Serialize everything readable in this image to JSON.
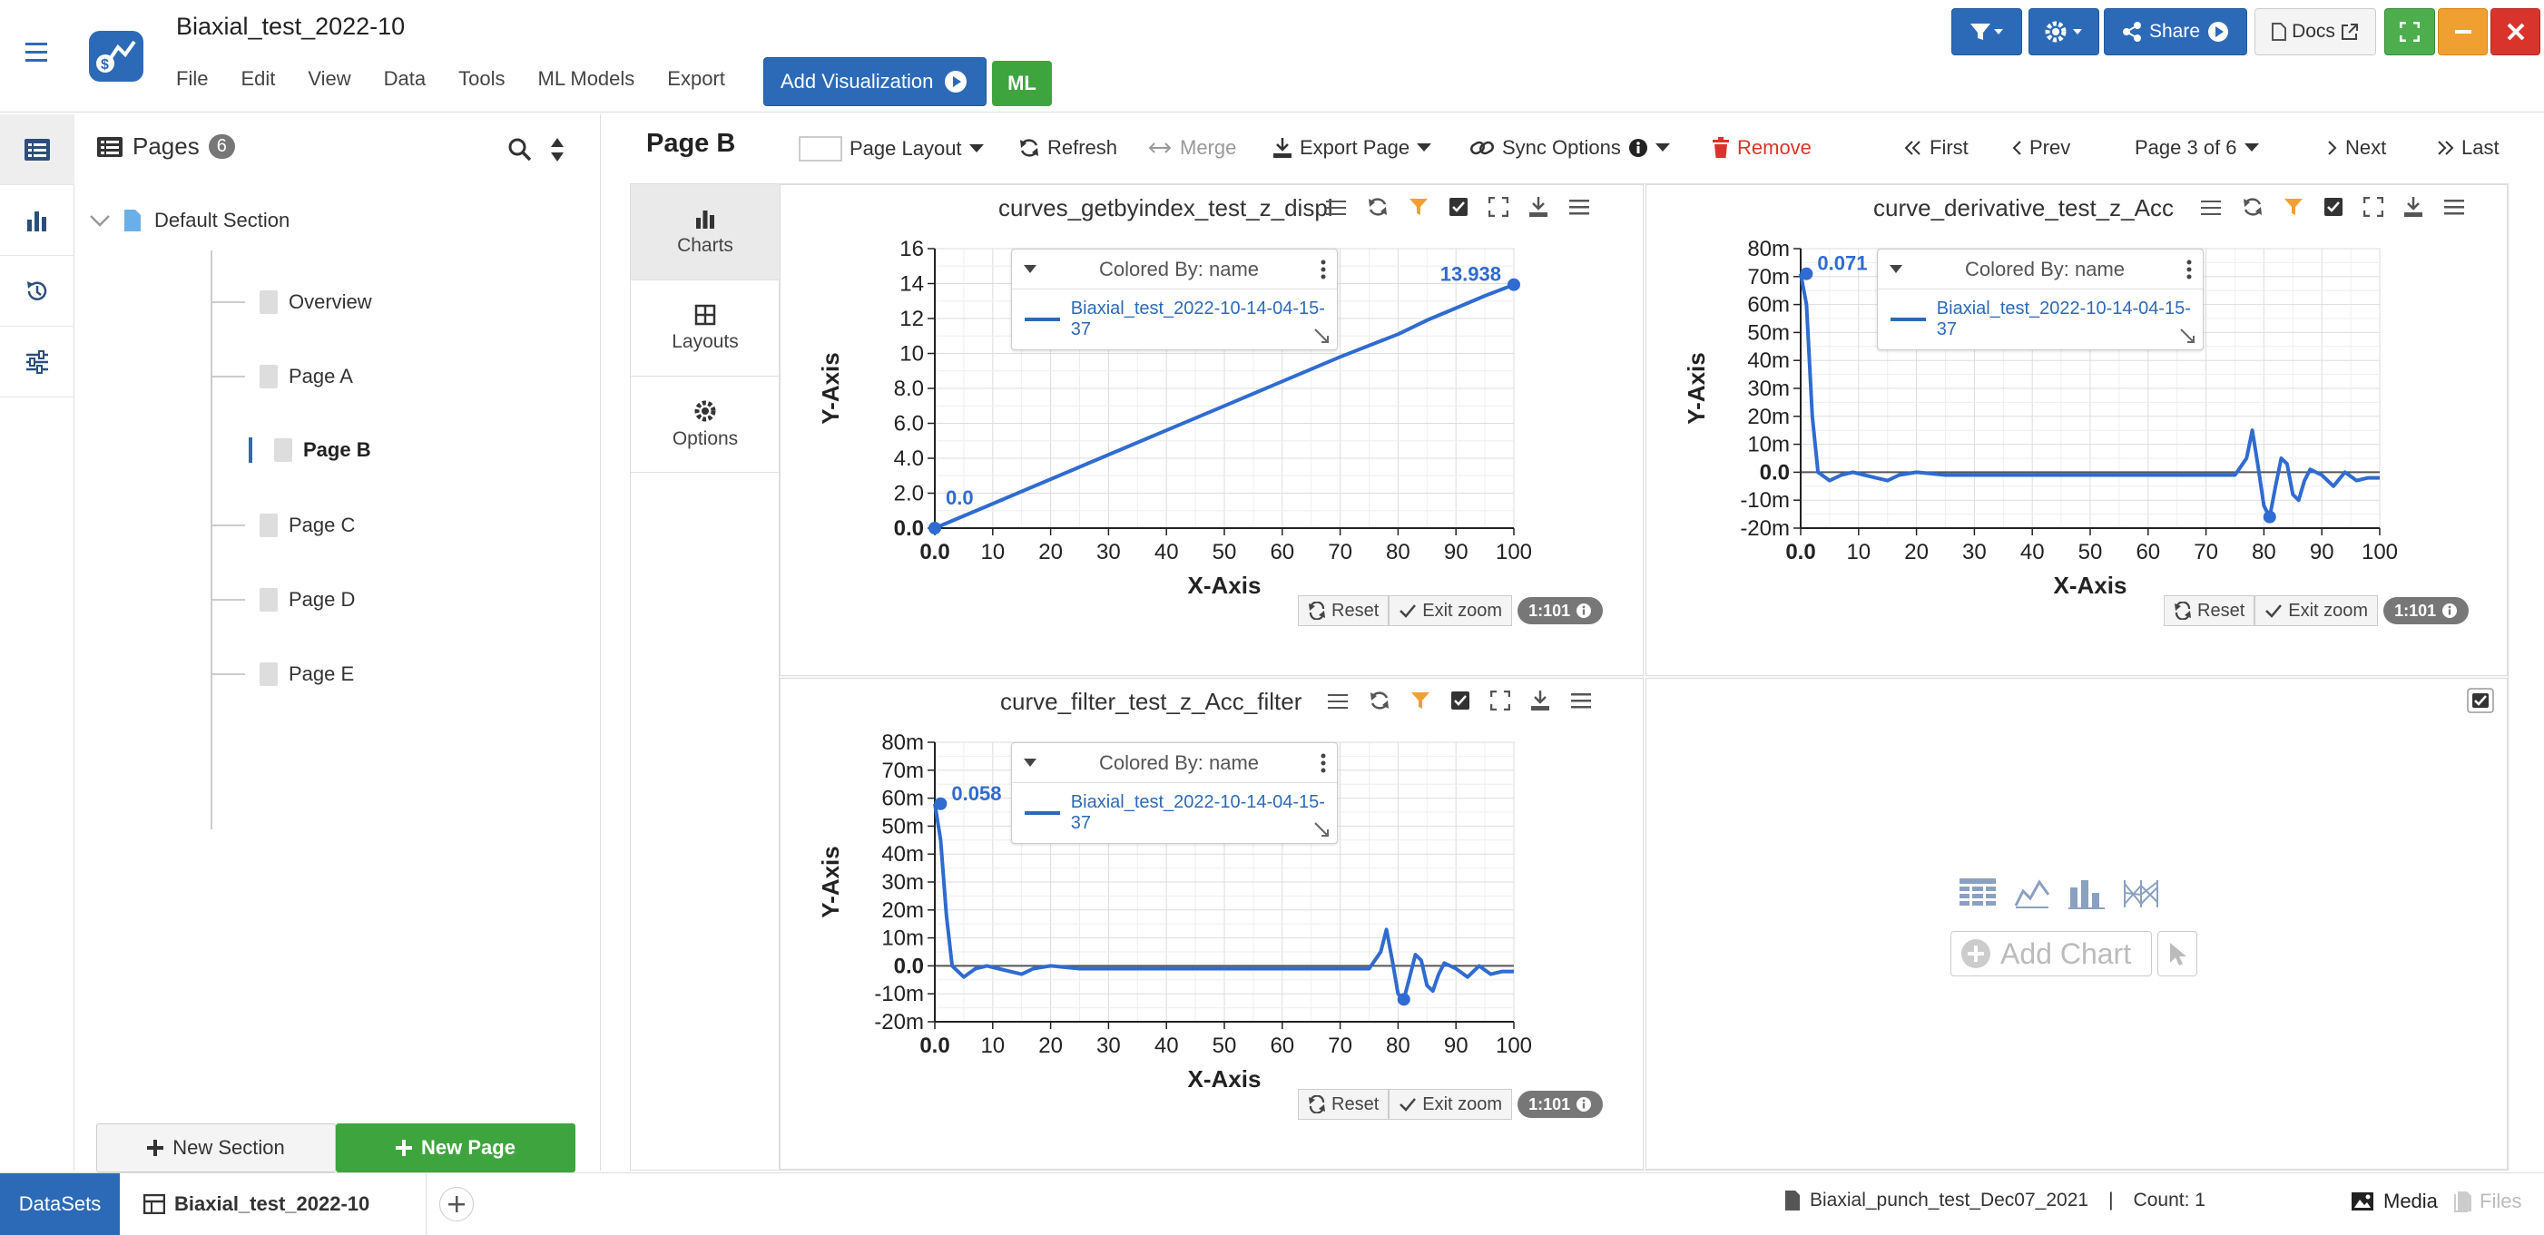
{
  "header": {
    "app_title": "Biaxial_test_2022-10",
    "menu": [
      "File",
      "Edit",
      "View",
      "Data",
      "Tools",
      "ML Models",
      "Export"
    ],
    "add_visualization": "Add Visualization",
    "ml": "ML",
    "share": "Share",
    "docs": "Docs"
  },
  "pages_panel": {
    "title": "Pages",
    "count": "6",
    "section": "Default Section",
    "pages": [
      "Overview",
      "Page A",
      "Page B",
      "Page C",
      "Page D",
      "Page E"
    ],
    "active_page": "Page B",
    "new_section": "New Section",
    "new_page": "New Page"
  },
  "toolbar": {
    "page_title": "Page B",
    "page_layout": "Page Layout",
    "refresh": "Refresh",
    "merge": "Merge",
    "export_page": "Export Page",
    "sync_options": "Sync Options",
    "remove": "Remove",
    "first": "First",
    "prev": "Prev",
    "page_indicator": "Page 3 of 6",
    "next": "Next",
    "last": "Last"
  },
  "side_tabs": [
    "Charts",
    "Layouts",
    "Options"
  ],
  "legend": {
    "colored_by": "Colored By: name",
    "entry": "Biaxial_test_2022-10-14-04-15-37"
  },
  "zoom": {
    "reset": "Reset",
    "exit_zoom": "Exit zoom",
    "ratio": "1:101"
  },
  "empty_panel": {
    "add_chart": "Add Chart"
  },
  "chart_data": [
    {
      "type": "line",
      "title": "curves_getbyindex_test_z_displ",
      "xlabel": "X-Axis",
      "ylabel": "Y-Axis",
      "xlim": [
        0,
        100
      ],
      "ylim": [
        0,
        16
      ],
      "xticks": [
        "0.0",
        "10",
        "20",
        "30",
        "40",
        "50",
        "60",
        "70",
        "80",
        "90",
        "100"
      ],
      "yticks": [
        "0.0",
        "2.0",
        "4.0",
        "6.0",
        "8.0",
        "10",
        "12",
        "14",
        "16"
      ],
      "series": [
        {
          "name": "Biaxial_test_2022-10-14-04-15-37",
          "x": [
            0,
            10,
            20,
            30,
            40,
            50,
            60,
            70,
            80,
            85,
            90,
            95,
            100
          ],
          "y": [
            0,
            1.4,
            2.8,
            4.2,
            5.6,
            7.0,
            8.4,
            9.8,
            11.1,
            11.9,
            12.6,
            13.3,
            13.938
          ]
        }
      ],
      "annotations": [
        {
          "x": 0,
          "y": 0,
          "text": "0.0"
        },
        {
          "x": 100,
          "y": 13.938,
          "text": "13.938"
        }
      ]
    },
    {
      "type": "line",
      "title": "curve_derivative_test_z_Acc",
      "xlabel": "X-Axis",
      "ylabel": "Y-Axis",
      "xlim": [
        0,
        100
      ],
      "ylim": [
        -0.02,
        0.08
      ],
      "xticks": [
        "0.0",
        "10",
        "20",
        "30",
        "40",
        "50",
        "60",
        "70",
        "80",
        "90",
        "100"
      ],
      "yticks": [
        "-20m",
        "-10m",
        "0.0",
        "10m",
        "20m",
        "30m",
        "40m",
        "50m",
        "60m",
        "70m",
        "80m"
      ],
      "series": [
        {
          "name": "Biaxial_test_2022-10-14-04-15-37",
          "x": [
            0,
            1,
            2,
            3,
            5,
            7,
            9,
            11,
            13,
            15,
            17,
            20,
            25,
            30,
            40,
            50,
            60,
            70,
            75,
            77,
            78,
            79,
            80,
            81,
            82,
            83,
            84,
            85,
            86,
            87,
            88,
            90,
            92,
            94,
            96,
            98,
            100
          ],
          "y": [
            0.071,
            0.06,
            0.02,
            0.0,
            -0.003,
            -0.001,
            0.0,
            -0.001,
            -0.002,
            -0.003,
            -0.001,
            0.0,
            -0.001,
            -0.001,
            -0.001,
            -0.001,
            -0.001,
            -0.001,
            -0.001,
            0.005,
            0.015,
            0.002,
            -0.012,
            -0.016,
            -0.005,
            0.005,
            0.003,
            -0.008,
            -0.01,
            -0.003,
            0.001,
            -0.001,
            -0.005,
            0.0,
            -0.003,
            -0.002,
            -0.002
          ]
        }
      ],
      "annotations": [
        {
          "x": 1,
          "y": 0.071,
          "text": "0.071"
        }
      ]
    },
    {
      "type": "line",
      "title": "curve_filter_test_z_Acc_filter",
      "xlabel": "X-Axis",
      "ylabel": "Y-Axis",
      "xlim": [
        0,
        100
      ],
      "ylim": [
        -0.02,
        0.08
      ],
      "xticks": [
        "0.0",
        "10",
        "20",
        "30",
        "40",
        "50",
        "60",
        "70",
        "80",
        "90",
        "100"
      ],
      "yticks": [
        "-20m",
        "-10m",
        "0.0",
        "10m",
        "20m",
        "30m",
        "40m",
        "50m",
        "60m",
        "70m",
        "80m"
      ],
      "series": [
        {
          "name": "Biaxial_test_2022-10-14-04-15-37",
          "x": [
            0,
            1,
            2,
            3,
            5,
            7,
            9,
            11,
            13,
            15,
            17,
            20,
            25,
            30,
            40,
            50,
            60,
            70,
            75,
            77,
            78,
            79,
            80,
            81,
            82,
            83,
            84,
            85,
            86,
            87,
            88,
            90,
            92,
            94,
            96,
            98,
            100
          ],
          "y": [
            0.058,
            0.045,
            0.018,
            0.0,
            -0.004,
            -0.001,
            0.0,
            -0.001,
            -0.002,
            -0.003,
            -0.001,
            0.0,
            -0.001,
            -0.001,
            -0.001,
            -0.001,
            -0.001,
            -0.001,
            -0.001,
            0.005,
            0.013,
            0.002,
            -0.01,
            -0.012,
            -0.004,
            0.004,
            0.002,
            -0.007,
            -0.009,
            -0.003,
            0.001,
            -0.001,
            -0.004,
            0.0,
            -0.003,
            -0.002,
            -0.002
          ]
        }
      ],
      "annotations": [
        {
          "x": 1,
          "y": 0.058,
          "text": "0.058"
        }
      ]
    }
  ],
  "statusbar": {
    "datasets": "DataSets",
    "dataset_tab": "Biaxial_test_2022-10",
    "file": "Biaxial_punch_test_Dec07_2021",
    "separator": "|",
    "count": "Count: 1",
    "media": "Media",
    "files": "Files"
  }
}
